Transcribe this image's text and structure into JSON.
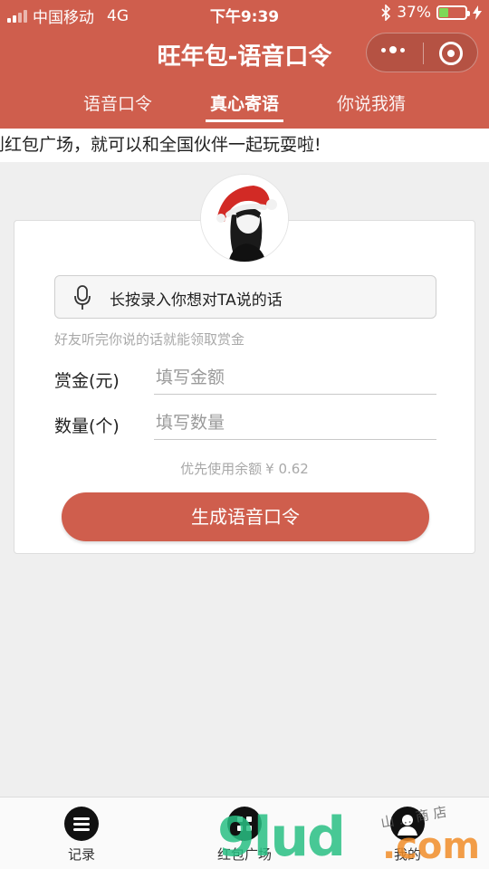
{
  "status_bar": {
    "carrier": "中国移动",
    "network": "4G",
    "time": "下午9:39",
    "battery_percent": "37%",
    "battery_level": 0.37,
    "icons": [
      "signal-icon",
      "bluetooth-icon",
      "battery-icon",
      "charging-icon"
    ]
  },
  "header": {
    "title": "旺年包-语音口令",
    "capsule_icons": [
      "more-dots-icon",
      "close-target-icon"
    ],
    "color": "#cf5e4d"
  },
  "tabs": [
    {
      "label": "语音口令",
      "active": false
    },
    {
      "label": "真心寄语",
      "active": true
    },
    {
      "label": "你说我猜",
      "active": false
    }
  ],
  "marquee": {
    "text": "到红包广场，就可以和全国伙伴一起玩耍啦!"
  },
  "card": {
    "avatar_icon": "santa-hat-avatar",
    "voice_button_label": "长按录入你想对TA说的话",
    "voice_hint": "好友听完你说的话就能领取赏金",
    "reward_label": "赏金(元)",
    "reward_placeholder": "填写金额",
    "count_label": "数量(个)",
    "count_placeholder": "填写数量",
    "balance_text": "优先使用余额",
    "balance_amount": "¥ 0.62",
    "generate_button_label": "生成语音口令"
  },
  "tab_bar": {
    "items": [
      {
        "label": "记录",
        "icon": "list-icon"
      },
      {
        "label": "红包广场",
        "icon": "grid-icon"
      },
      {
        "label": "我的",
        "icon": "user-icon"
      }
    ]
  },
  "watermark": {
    "brand": "9lud",
    "suffix": ".com",
    "handwriting": "山 ... 商 店"
  }
}
